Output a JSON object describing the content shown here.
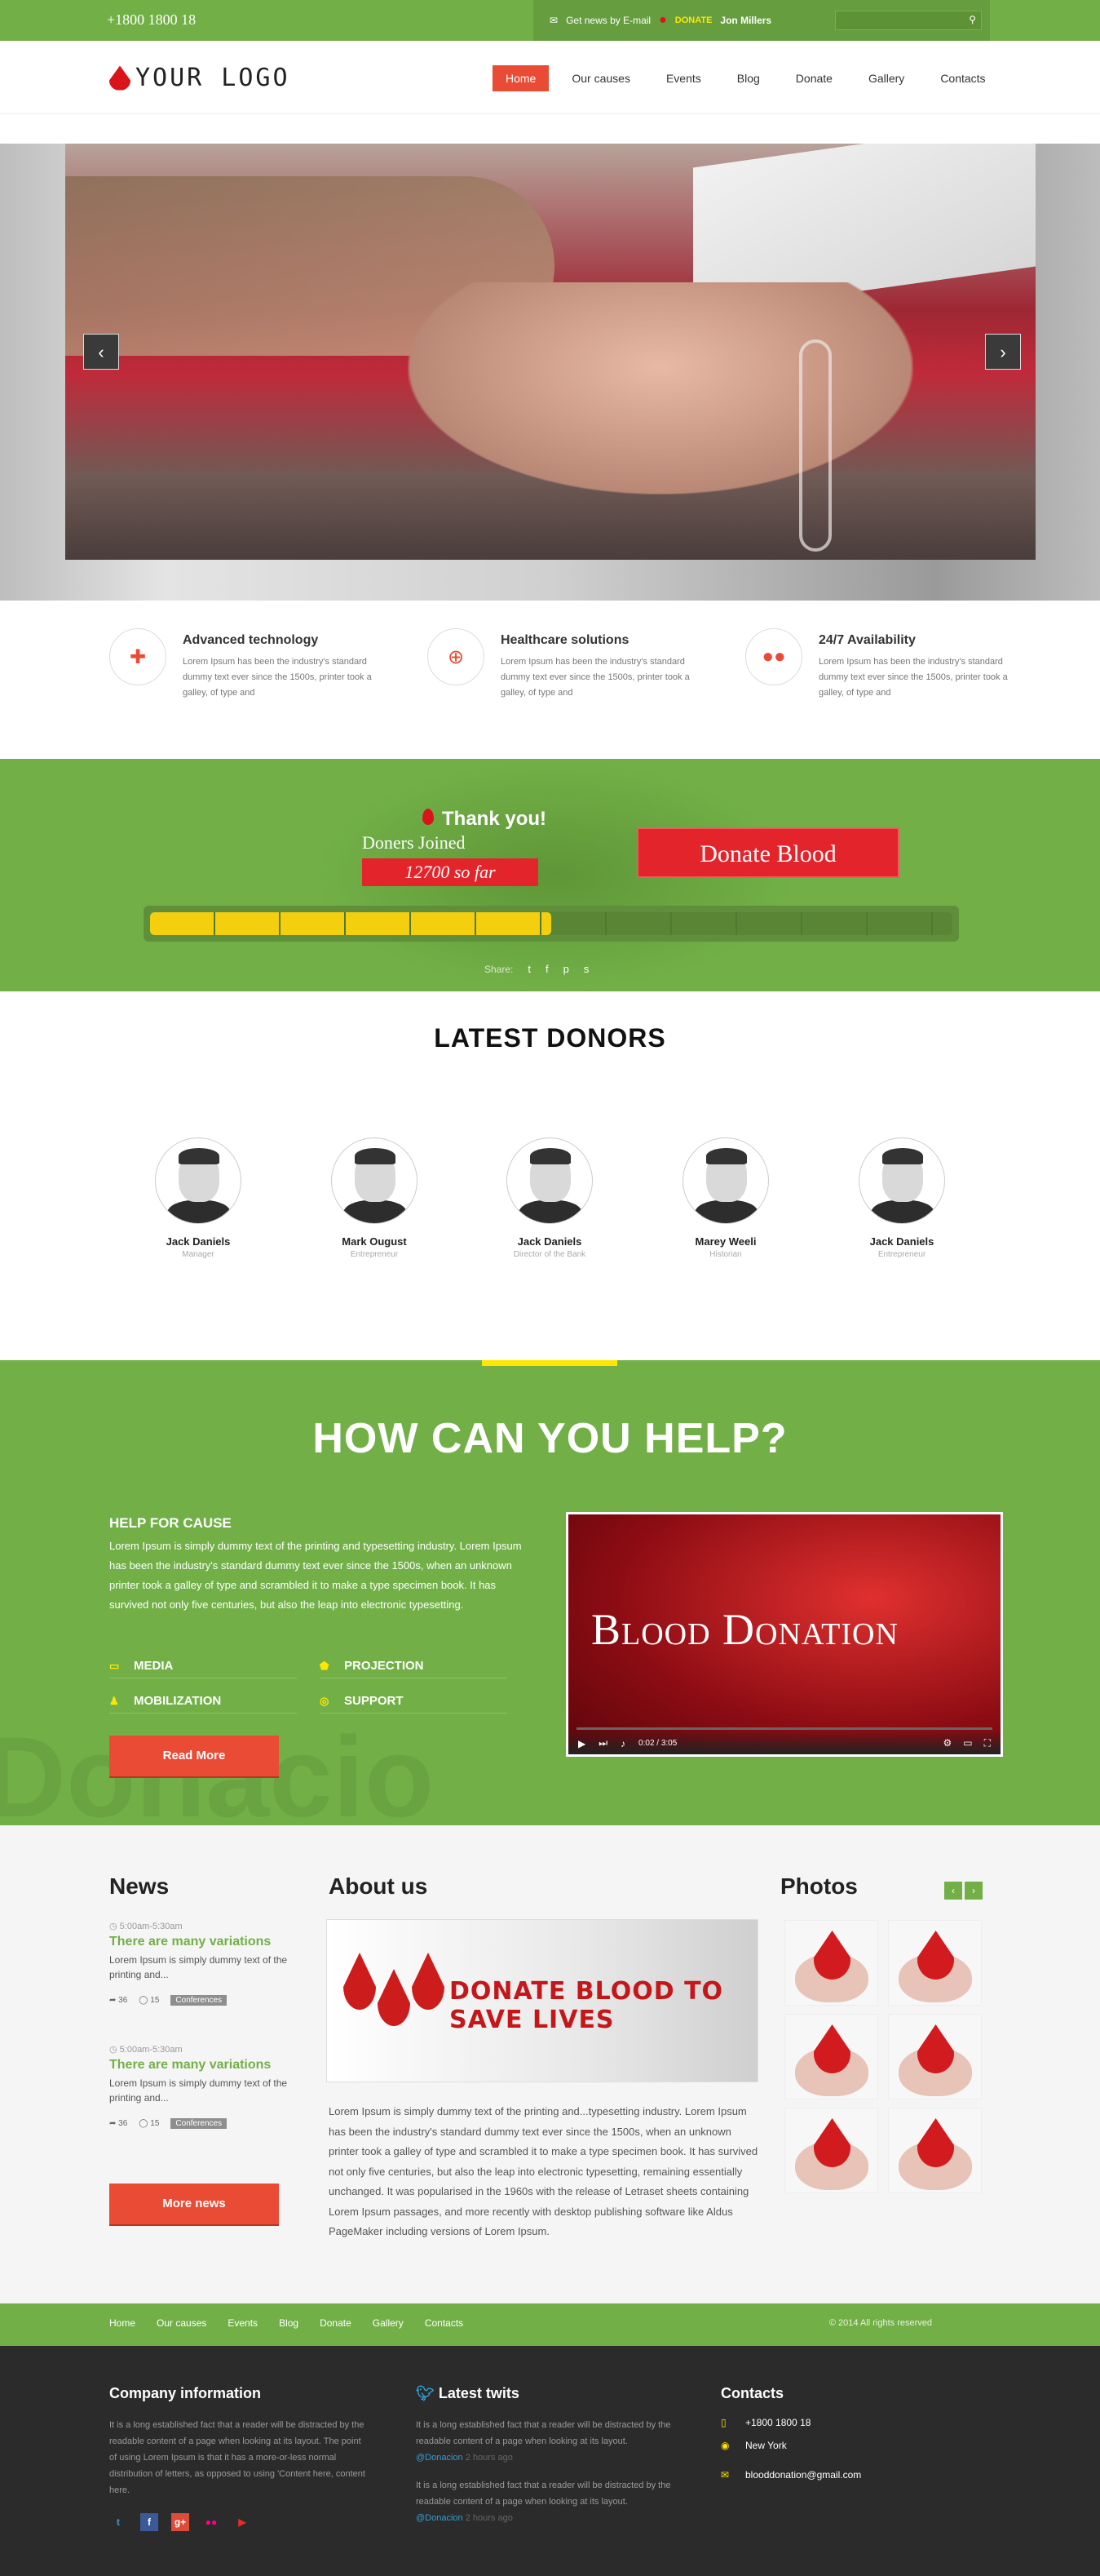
{
  "topbar": {
    "phone": "+1800 1800 18",
    "news": "Get news by E-mail",
    "donate": "DONATE",
    "user": "Jon Millers",
    "search_icon": "search-icon"
  },
  "logo": {
    "text": "YOUR LOGO"
  },
  "nav": [
    "Home",
    "Our causes",
    "Events",
    "Blog",
    "Donate",
    "Gallery",
    "Contacts"
  ],
  "features": [
    {
      "title": "Advanced technology",
      "text": "Lorem Ipsum has been the industry's standard dummy text ever since the 1500s, printer took a galley, of type and",
      "icon": "medkit-icon"
    },
    {
      "title": "Healthcare solutions",
      "text": "Lorem Ipsum has been the industry's standard dummy text ever since the 1500s, printer took a galley, of type and",
      "icon": "globe-icon"
    },
    {
      "title": "24/7 Availability",
      "text": "Lorem Ipsum has been the industry's standard dummy text ever since the 1500s, printer took a galley, of type and",
      "icon": "blood-drops-icon"
    }
  ],
  "donate_band": {
    "thanks": "Thank you!",
    "joined": "Doners Joined",
    "count": "12700 so far",
    "button": "Donate Blood",
    "progress": 0.5,
    "share": "Share:"
  },
  "donors": {
    "title": "LATEST DONORS",
    "items": [
      {
        "name": "Jack Daniels",
        "role": "Manager"
      },
      {
        "name": "Mark Ougust",
        "role": "Entrepreneur"
      },
      {
        "name": "Jack Daniels",
        "role": "Director of the Bank"
      },
      {
        "name": "Marey Weeli",
        "role": "Historian"
      },
      {
        "name": "Jack Daniels",
        "role": "Entrepreneur"
      }
    ]
  },
  "help": {
    "title": "HOW CAN YOU HELP?",
    "subtitle": "HELP FOR CAUSE",
    "text": "Lorem Ipsum is simply dummy text of the printing and typesetting industry. Lorem Ipsum has been the industry's standard dummy text ever since the 1500s, when an unknown printer took a galley of type and scrambled it to make a type specimen book. It has survived not only five centuries, but also the leap into electronic typesetting.",
    "items": [
      "MEDIA",
      "PROJECTION",
      "MOBILIZATION",
      "SUPPORT"
    ],
    "button": "Read More",
    "watermark": "Donacio",
    "video_title": "Blood Donation",
    "video_time": "0:02 / 3:05"
  },
  "news": {
    "title": "News",
    "items": [
      {
        "time": "5:00am-5:30am",
        "title": "There are many variations",
        "text": "Lorem Ipsum is simply dummy text of the printing and...",
        "shares": "36",
        "comments": "15",
        "tag": "Conferences"
      },
      {
        "time": "5:00am-5:30am",
        "title": "There are many variations",
        "text": "Lorem Ipsum is simply dummy text of the printing and...",
        "shares": "36",
        "comments": "15",
        "tag": "Conferences"
      }
    ],
    "button": "More news"
  },
  "about": {
    "title": "About us",
    "banner": "DONATE BLOOD TO SAVE LIVES",
    "text": "Lorem Ipsum is simply dummy text of the printing and...typesetting industry. Lorem Ipsum has been the industry's standard dummy text ever since the 1500s, when an unknown printer took a galley of type and scrambled it to make a type specimen book. It has survived not only five centuries, but also the leap into electronic typesetting, remaining essentially unchanged. It was popularised in the 1960s with the release of Letraset sheets containing Lorem Ipsum passages, and more recently with desktop publishing software like Aldus PageMaker including versions of Lorem Ipsum."
  },
  "photos": {
    "title": "Photos"
  },
  "footer_nav": {
    "links": [
      "Home",
      "Our causes",
      "Events",
      "Blog",
      "Donate",
      "Gallery",
      "Contacts"
    ],
    "copy": "© 2014 All rights reserved"
  },
  "footer": {
    "company": {
      "title": "Company information",
      "text": "It is a long established fact that a reader will be distracted by the readable content of a page when looking at its layout. The point of using Lorem Ipsum is that it has a more-or-less normal distribution of letters, as opposed to using 'Content here, content here."
    },
    "twits": {
      "title": "Latest twits",
      "items": [
        {
          "text": "It is a long established fact that a reader will be distracted by the readable content of a page when looking at its layout.",
          "handle": "@Donacion",
          "ago": "2 hours ago"
        },
        {
          "text": "It is a long established fact that a reader will be distracted by the readable content of a page when looking at its layout.",
          "handle": "@Donacion",
          "ago": "2 hours ago"
        }
      ]
    },
    "contacts": {
      "title": "Contacts",
      "phone": "+1800 1800 18",
      "city": "New York",
      "email": "blooddonation@gmail.com"
    }
  },
  "colors": {
    "green": "#72b047",
    "red": "#e94b35",
    "yellow": "#ffe600",
    "dark": "#2b2b2b"
  }
}
